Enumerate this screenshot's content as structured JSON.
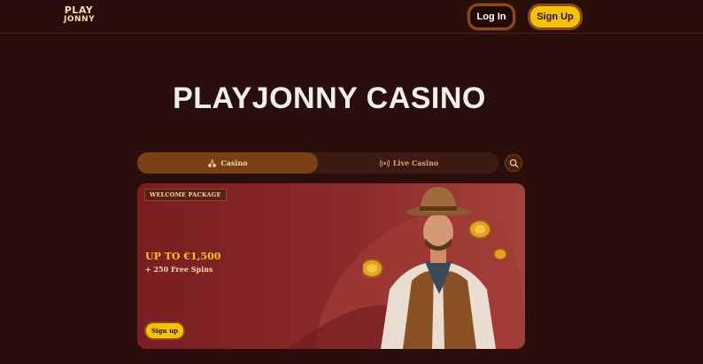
{
  "header": {
    "logo_line1": "PLAY",
    "logo_line2": "JONNY",
    "login_label": "Log In",
    "signup_label": "Sign Up"
  },
  "page": {
    "title": "PLAYJONNY CASINO"
  },
  "tabs": [
    {
      "label": "Casino",
      "icon": "cherries-icon",
      "active": true
    },
    {
      "label": "Live Casino",
      "icon": "broadcast-icon",
      "active": false
    }
  ],
  "search": {
    "icon": "search-icon"
  },
  "banner": {
    "badge": "WELCOME PACKAGE",
    "offer": "UP TO €1,500",
    "offer_sub": "+ 250 Free Spins",
    "cta_label": "Sign up",
    "image": "cowboy-with-coins"
  },
  "colors": {
    "background": "#2a0e0c",
    "accent_yellow": "#f5c20a",
    "banner_red": "#8a2a2a",
    "tab_active": "#7a3f15"
  }
}
